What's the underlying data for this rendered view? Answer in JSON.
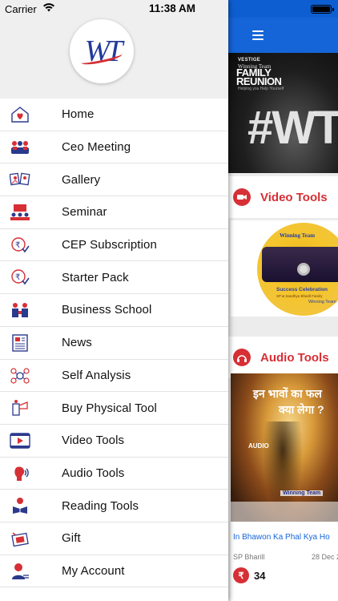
{
  "status_bar": {
    "carrier": "Carrier",
    "time": "11:38 AM"
  },
  "drawer": {
    "logo_text": "WT",
    "menu": [
      {
        "label": "Home",
        "icon": "home-heart-icon"
      },
      {
        "label": "Ceo Meeting",
        "icon": "meeting-icon"
      },
      {
        "label": "Gallery",
        "icon": "gallery-icon"
      },
      {
        "label": "Seminar",
        "icon": "seminar-icon"
      },
      {
        "label": "CEP Subscription",
        "icon": "subscription-icon"
      },
      {
        "label": "Starter Pack",
        "icon": "starter-pack-icon"
      },
      {
        "label": "Business School",
        "icon": "business-school-icon"
      },
      {
        "label": "News",
        "icon": "news-icon"
      },
      {
        "label": "Self Analysis",
        "icon": "self-analysis-icon"
      },
      {
        "label": "Buy Physical Tool",
        "icon": "physical-tool-icon"
      },
      {
        "label": "Video Tools",
        "icon": "video-icon"
      },
      {
        "label": "Audio Tools",
        "icon": "audio-icon"
      },
      {
        "label": "Reading Tools",
        "icon": "reading-icon"
      },
      {
        "label": "Gift",
        "icon": "gift-icon"
      },
      {
        "label": "My Account",
        "icon": "account-icon"
      }
    ]
  },
  "content": {
    "banner": {
      "brand": "VESTIGE",
      "brand2": "Winning Team",
      "title_line1": "FAMILY",
      "title_line2": "REUNION",
      "tagline": "Helping you Help Yourself",
      "hashtag": "#WT"
    },
    "video_section": {
      "title": "Video Tools",
      "disc_brand": "Winning Team",
      "disc_caption": "Success Celebration",
      "disc_subcaption": "SP & Sandhya Bharill Family",
      "disc_footer": "Winning Team"
    },
    "audio_section": {
      "title": "Audio Tools",
      "hindi_line1": "इन भावों का फल",
      "hindi_line2": "क्या लेगा ?",
      "image_label": "AUDIO",
      "image_brand": "Winning Team",
      "item_title": "In Bhawon Ka Phal Kya Ho",
      "author": "SP Bharill",
      "date": "28 Dec 20",
      "currency_symbol": "₹",
      "price": "34"
    }
  },
  "colors": {
    "accent_red": "#d62f35",
    "app_bar_blue": "#1565d8",
    "logo_blue": "#233a9b"
  }
}
